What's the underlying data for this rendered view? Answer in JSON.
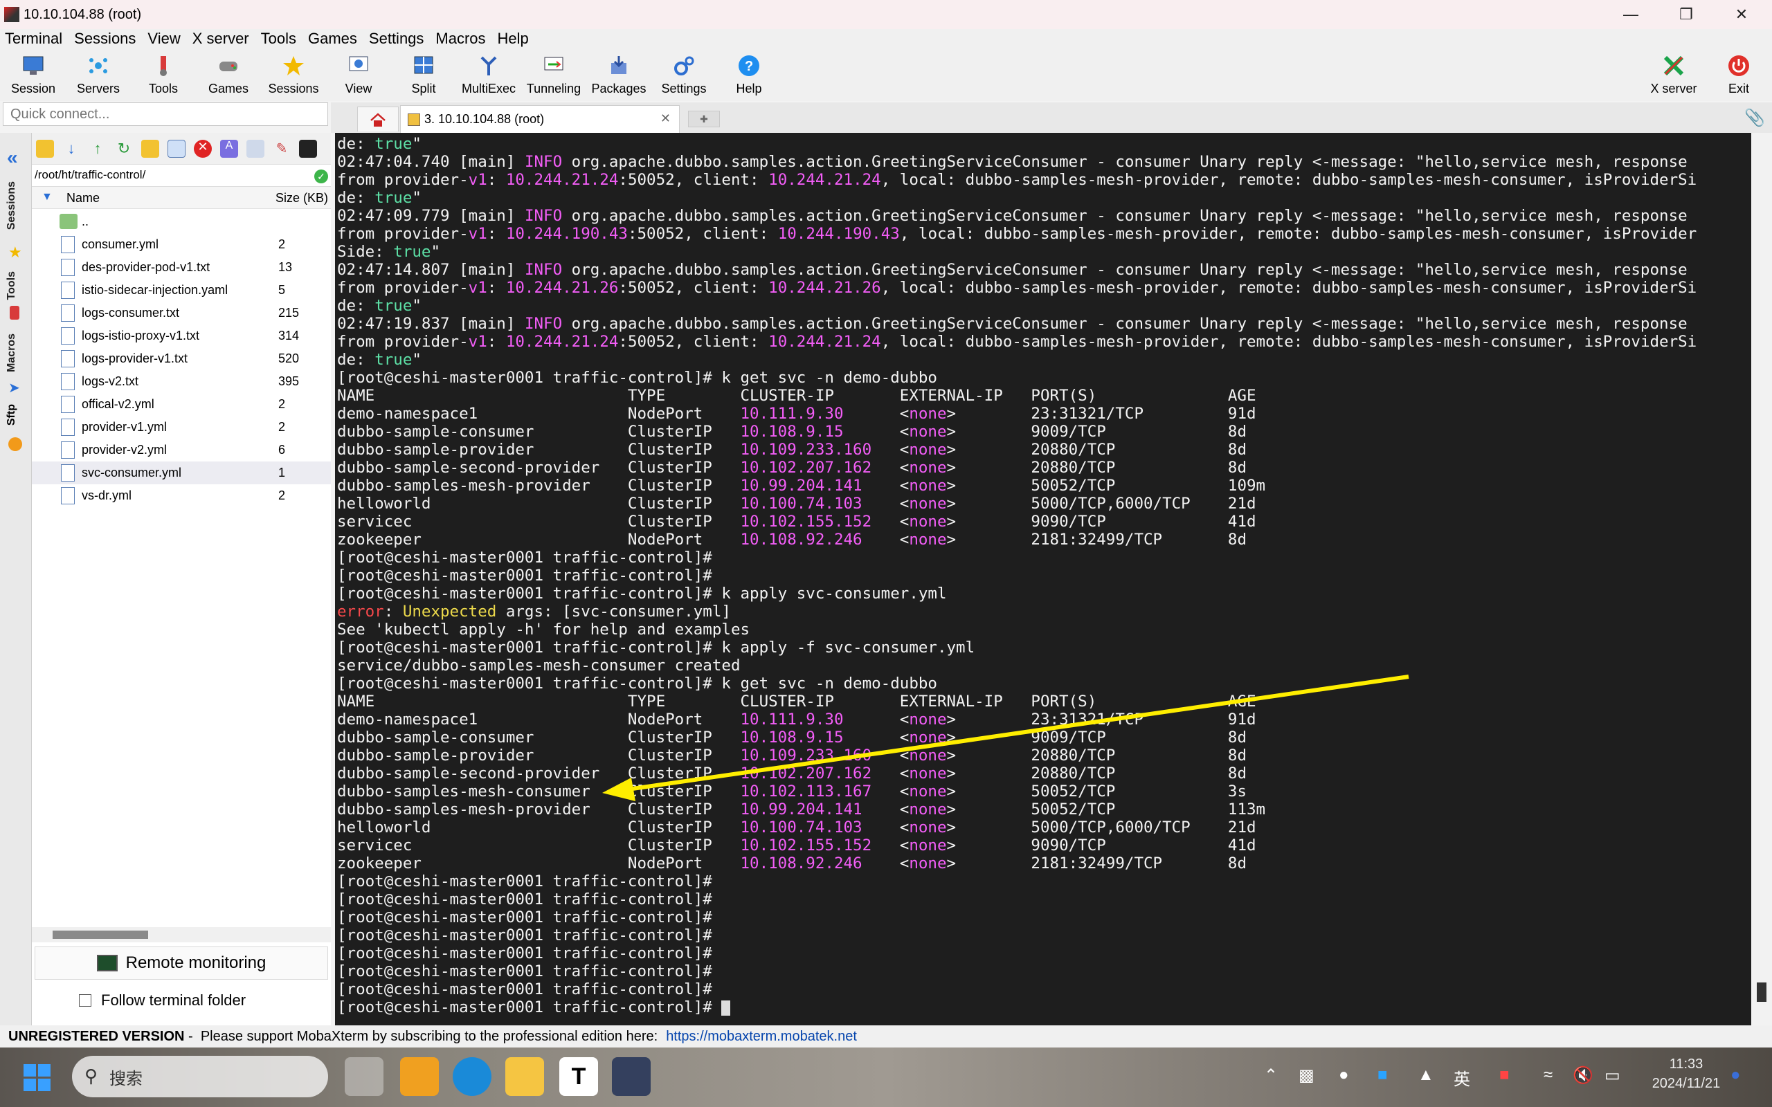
{
  "window": {
    "title": "10.10.104.88 (root)"
  },
  "menu": [
    "Terminal",
    "Sessions",
    "View",
    "X server",
    "Tools",
    "Games",
    "Settings",
    "Macros",
    "Help"
  ],
  "toolbar": {
    "session": "Session",
    "servers": "Servers",
    "tools": "Tools",
    "games": "Games",
    "sessions": "Sessions",
    "view": "View",
    "split": "Split",
    "multiexec": "MultiExec",
    "tunneling": "Tunneling",
    "packages": "Packages",
    "settings": "Settings",
    "help": "Help",
    "xserver": "X server",
    "exit": "Exit"
  },
  "quick_connect": {
    "placeholder": "Quick connect..."
  },
  "tab": {
    "label": "3. 10.10.104.88 (root)"
  },
  "sidebar_tabs": [
    "Sessions",
    "Tools",
    "Macros",
    "Sftp"
  ],
  "sftp": {
    "path": "/root/ht/traffic-control/",
    "col_name": "Name",
    "col_size": "Size (KB)",
    "parent": "..",
    "files": [
      {
        "name": "consumer.yml",
        "size": "2"
      },
      {
        "name": "des-provider-pod-v1.txt",
        "size": "13"
      },
      {
        "name": "istio-sidecar-injection.yaml",
        "size": "5"
      },
      {
        "name": "logs-consumer.txt",
        "size": "215"
      },
      {
        "name": "logs-istio-proxy-v1.txt",
        "size": "314"
      },
      {
        "name": "logs-provider-v1.txt",
        "size": "520"
      },
      {
        "name": "logs-v2.txt",
        "size": "395"
      },
      {
        "name": "offical-v2.yml",
        "size": "2"
      },
      {
        "name": "provider-v1.yml",
        "size": "2"
      },
      {
        "name": "provider-v2.yml",
        "size": "6"
      },
      {
        "name": "svc-consumer.yml",
        "size": "1"
      },
      {
        "name": "vs-dr.yml",
        "size": "2"
      }
    ],
    "remote_monitoring": "Remote monitoring",
    "follow_folder": "Follow terminal folder"
  },
  "terminal": {
    "lines": [
      [
        [
          "de: ",
          ""
        ],
        [
          "true",
          "g"
        ],
        [
          "\"",
          ""
        ]
      ],
      [
        [
          "02:47:04.740 [main] ",
          ""
        ],
        [
          "INFO",
          "m"
        ],
        [
          " org.apache.dubbo.samples.action.GreetingServiceConsumer - consumer Unary reply <-message: \"hello,service mesh, response",
          ""
        ]
      ],
      [
        [
          "from provider-",
          ""
        ],
        [
          "v1",
          "m"
        ],
        [
          ": ",
          ""
        ],
        [
          "10.244.21.24",
          "m"
        ],
        [
          ":50052, client: ",
          ""
        ],
        [
          "10.244.21.24",
          "m"
        ],
        [
          ", local: dubbo-samples-mesh-provider, remote: dubbo-samples-mesh-consumer, isProviderSi",
          ""
        ]
      ],
      [
        [
          "de: ",
          ""
        ],
        [
          "true",
          "g"
        ],
        [
          "\"",
          ""
        ]
      ],
      [
        [
          "02:47:09.779 [main] ",
          ""
        ],
        [
          "INFO",
          "m"
        ],
        [
          " org.apache.dubbo.samples.action.GreetingServiceConsumer - consumer Unary reply <-message: \"hello,service mesh, response",
          ""
        ]
      ],
      [
        [
          "from provider-",
          ""
        ],
        [
          "v1",
          "m"
        ],
        [
          ": ",
          ""
        ],
        [
          "10.244.190.43",
          "m"
        ],
        [
          ":50052, client: ",
          ""
        ],
        [
          "10.244.190.43",
          "m"
        ],
        [
          ", local: dubbo-samples-mesh-provider, remote: dubbo-samples-mesh-consumer, isProvider",
          ""
        ]
      ],
      [
        [
          "Side: ",
          ""
        ],
        [
          "true",
          "g"
        ],
        [
          "\"",
          ""
        ]
      ],
      [
        [
          "02:47:14.807 [main] ",
          ""
        ],
        [
          "INFO",
          "m"
        ],
        [
          " org.apache.dubbo.samples.action.GreetingServiceConsumer - consumer Unary reply <-message: \"hello,service mesh, response",
          ""
        ]
      ],
      [
        [
          "from provider-",
          ""
        ],
        [
          "v1",
          "m"
        ],
        [
          ": ",
          ""
        ],
        [
          "10.244.21.26",
          "m"
        ],
        [
          ":50052, client: ",
          ""
        ],
        [
          "10.244.21.26",
          "m"
        ],
        [
          ", local: dubbo-samples-mesh-provider, remote: dubbo-samples-mesh-consumer, isProviderSi",
          ""
        ]
      ],
      [
        [
          "de: ",
          ""
        ],
        [
          "true",
          "g"
        ],
        [
          "\"",
          ""
        ]
      ],
      [
        [
          "02:47:19.837 [main] ",
          ""
        ],
        [
          "INFO",
          "m"
        ],
        [
          " org.apache.dubbo.samples.action.GreetingServiceConsumer - consumer Unary reply <-message: \"hello,service mesh, response",
          ""
        ]
      ],
      [
        [
          "from provider-",
          ""
        ],
        [
          "v1",
          "m"
        ],
        [
          ": ",
          ""
        ],
        [
          "10.244.21.24",
          "m"
        ],
        [
          ":50052, client: ",
          ""
        ],
        [
          "10.244.21.24",
          "m"
        ],
        [
          ", local: dubbo-samples-mesh-provider, remote: dubbo-samples-mesh-consumer, isProviderSi",
          ""
        ]
      ],
      [
        [
          "de: ",
          ""
        ],
        [
          "true",
          "g"
        ],
        [
          "\"",
          ""
        ]
      ],
      [
        [
          "[root@ceshi-master0001 traffic-control]# k get svc -n demo-dubbo",
          ""
        ]
      ],
      [
        [
          "NAME                           TYPE        CLUSTER-IP       EXTERNAL-IP   PORT(S)              AGE",
          ""
        ]
      ],
      [
        [
          "demo-namespace1                NodePort    ",
          ""
        ],
        [
          "10.111.9.30",
          "m"
        ],
        [
          "      <",
          ""
        ],
        [
          "none",
          "m"
        ],
        [
          ">        23:31321/TCP         91d",
          ""
        ]
      ],
      [
        [
          "dubbo-sample-consumer          ClusterIP   ",
          ""
        ],
        [
          "10.108.9.15",
          "m"
        ],
        [
          "      <",
          ""
        ],
        [
          "none",
          "m"
        ],
        [
          ">        9009/TCP             8d",
          ""
        ]
      ],
      [
        [
          "dubbo-sample-provider          ClusterIP   ",
          ""
        ],
        [
          "10.109.233.160",
          "m"
        ],
        [
          "   <",
          ""
        ],
        [
          "none",
          "m"
        ],
        [
          ">        20880/TCP            8d",
          ""
        ]
      ],
      [
        [
          "dubbo-sample-second-provider   ClusterIP   ",
          ""
        ],
        [
          "10.102.207.162",
          "m"
        ],
        [
          "   <",
          ""
        ],
        [
          "none",
          "m"
        ],
        [
          ">        20880/TCP            8d",
          ""
        ]
      ],
      [
        [
          "dubbo-samples-mesh-provider    ClusterIP   ",
          ""
        ],
        [
          "10.99.204.141",
          "m"
        ],
        [
          "    <",
          ""
        ],
        [
          "none",
          "m"
        ],
        [
          ">        50052/TCP            109m",
          ""
        ]
      ],
      [
        [
          "helloworld                     ClusterIP   ",
          ""
        ],
        [
          "10.100.74.103",
          "m"
        ],
        [
          "    <",
          ""
        ],
        [
          "none",
          "m"
        ],
        [
          ">        5000/TCP,6000/TCP    21d",
          ""
        ]
      ],
      [
        [
          "servicec                       ClusterIP   ",
          ""
        ],
        [
          "10.102.155.152",
          "m"
        ],
        [
          "   <",
          ""
        ],
        [
          "none",
          "m"
        ],
        [
          ">        9090/TCP             41d",
          ""
        ]
      ],
      [
        [
          "zookeeper                      NodePort    ",
          ""
        ],
        [
          "10.108.92.246",
          "m"
        ],
        [
          "    <",
          ""
        ],
        [
          "none",
          "m"
        ],
        [
          ">        2181:32499/TCP       8d",
          ""
        ]
      ],
      [
        [
          "[root@ceshi-master0001 traffic-control]#",
          ""
        ]
      ],
      [
        [
          "[root@ceshi-master0001 traffic-control]#",
          ""
        ]
      ],
      [
        [
          "[root@ceshi-master0001 traffic-control]# k apply svc-consumer.yml",
          ""
        ]
      ],
      [
        [
          "error",
          "r"
        ],
        [
          ": ",
          ""
        ],
        [
          "Unexpected",
          "y"
        ],
        [
          " args: [svc-consumer.yml]",
          ""
        ]
      ],
      [
        [
          "See 'kubectl apply -h' for help and examples",
          ""
        ]
      ],
      [
        [
          "[root@ceshi-master0001 traffic-control]# k apply -f svc-consumer.yml",
          ""
        ]
      ],
      [
        [
          "service/dubbo-samples-mesh-consumer created",
          ""
        ]
      ],
      [
        [
          "[root@ceshi-master0001 traffic-control]# k get svc -n demo-dubbo",
          ""
        ]
      ],
      [
        [
          "NAME                           TYPE        CLUSTER-IP       EXTERNAL-IP   PORT(S)              AGE",
          ""
        ]
      ],
      [
        [
          "demo-namespace1                NodePort    ",
          ""
        ],
        [
          "10.111.9.30",
          "m"
        ],
        [
          "      <",
          ""
        ],
        [
          "none",
          "m"
        ],
        [
          ">        23:31321/TCP         91d",
          ""
        ]
      ],
      [
        [
          "dubbo-sample-consumer          ClusterIP   ",
          ""
        ],
        [
          "10.108.9.15",
          "m"
        ],
        [
          "      <",
          ""
        ],
        [
          "none",
          "m"
        ],
        [
          ">        9009/TCP             8d",
          ""
        ]
      ],
      [
        [
          "dubbo-sample-provider          ClusterIP   ",
          ""
        ],
        [
          "10.109.233.160",
          "m"
        ],
        [
          "   <",
          ""
        ],
        [
          "none",
          "m"
        ],
        [
          ">        20880/TCP            8d",
          ""
        ]
      ],
      [
        [
          "dubbo-sample-second-provider   ClusterIP   ",
          ""
        ],
        [
          "10.102.207.162",
          "m"
        ],
        [
          "   <",
          ""
        ],
        [
          "none",
          "m"
        ],
        [
          ">        20880/TCP            8d",
          ""
        ]
      ],
      [
        [
          "dubbo-samples-mesh-consumer    ClusterIP   ",
          ""
        ],
        [
          "10.102.113.167",
          "m"
        ],
        [
          "   <",
          ""
        ],
        [
          "none",
          "m"
        ],
        [
          ">        50052/TCP            3s",
          ""
        ]
      ],
      [
        [
          "dubbo-samples-mesh-provider    ClusterIP   ",
          ""
        ],
        [
          "10.99.204.141",
          "m"
        ],
        [
          "    <",
          ""
        ],
        [
          "none",
          "m"
        ],
        [
          ">        50052/TCP            113m",
          ""
        ]
      ],
      [
        [
          "helloworld                     ClusterIP   ",
          ""
        ],
        [
          "10.100.74.103",
          "m"
        ],
        [
          "    <",
          ""
        ],
        [
          "none",
          "m"
        ],
        [
          ">        5000/TCP,6000/TCP    21d",
          ""
        ]
      ],
      [
        [
          "servicec                       ClusterIP   ",
          ""
        ],
        [
          "10.102.155.152",
          "m"
        ],
        [
          "   <",
          ""
        ],
        [
          "none",
          "m"
        ],
        [
          ">        9090/TCP             41d",
          ""
        ]
      ],
      [
        [
          "zookeeper                      NodePort    ",
          ""
        ],
        [
          "10.108.92.246",
          "m"
        ],
        [
          "    <",
          ""
        ],
        [
          "none",
          "m"
        ],
        [
          ">        2181:32499/TCP       8d",
          ""
        ]
      ],
      [
        [
          "[root@ceshi-master0001 traffic-control]#",
          ""
        ]
      ],
      [
        [
          "[root@ceshi-master0001 traffic-control]#",
          ""
        ]
      ],
      [
        [
          "[root@ceshi-master0001 traffic-control]#",
          ""
        ]
      ],
      [
        [
          "[root@ceshi-master0001 traffic-control]#",
          ""
        ]
      ],
      [
        [
          "[root@ceshi-master0001 traffic-control]#",
          ""
        ]
      ],
      [
        [
          "[root@ceshi-master0001 traffic-control]#",
          ""
        ]
      ],
      [
        [
          "[root@ceshi-master0001 traffic-control]#",
          ""
        ]
      ],
      [
        [
          "[root@ceshi-master0001 traffic-control]# ",
          ""
        ]
      ]
    ]
  },
  "status": {
    "unregistered": "UNREGISTERED VERSION",
    "message": " -  Please support MobaXterm by subscribing to the professional edition here:",
    "link": "https://mobaxterm.mobatek.net"
  },
  "taskbar": {
    "search": "搜索",
    "ime": "英",
    "time": "11:33",
    "date": "2024/11/21"
  },
  "colors": {
    "terminal_bg": "#1e1e1e",
    "green": "#5de0a6",
    "magenta": "#f35ef7",
    "red": "#f5484b",
    "yellow": "#ecd94b",
    "annotation_arrow": "#ffee00"
  }
}
